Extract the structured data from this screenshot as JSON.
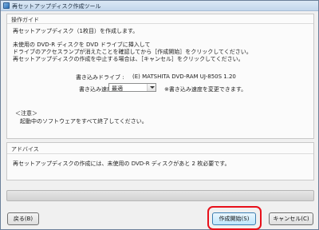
{
  "window": {
    "title": "再セットアップディスク作成ツール"
  },
  "guide": {
    "heading": "操作ガイド",
    "line1": "再セットアップディスク（1枚目）を作成します。",
    "line2": "未使用の DVD-R ディスクを DVD ドライブに挿入して",
    "line3": "ドライブのアクセスランプが消えたことを確認してから［作成開始］をクリックしてください。",
    "line4": "再セットアップディスクの作成を中止する場合は、［キャンセル］をクリックしてください。",
    "drive_label": "書き込みドライブ :",
    "drive_value": "(E) MATSHITA DVD-RAM UJ-850S 1.20",
    "speed_label": "書き込み速度 :",
    "speed_value": "最適",
    "speed_note": "※書き込み速度を変更できます。",
    "note_title": "＜注意＞",
    "note_text": "起動中のソフトウェアをすべて終了してください。"
  },
  "advice": {
    "heading": "アドバイス",
    "text": "再セットアップディスクの作成には、未使用の DVD-R ディスクがあと 2 枚必要です。"
  },
  "progress": {
    "value": 0
  },
  "buttons": {
    "back": "戻る(B)",
    "start": "作成開始(S)",
    "cancel": "キャンセル(C)"
  },
  "colors": {
    "highlight": "#e8101a",
    "progress": "#37b53c"
  }
}
